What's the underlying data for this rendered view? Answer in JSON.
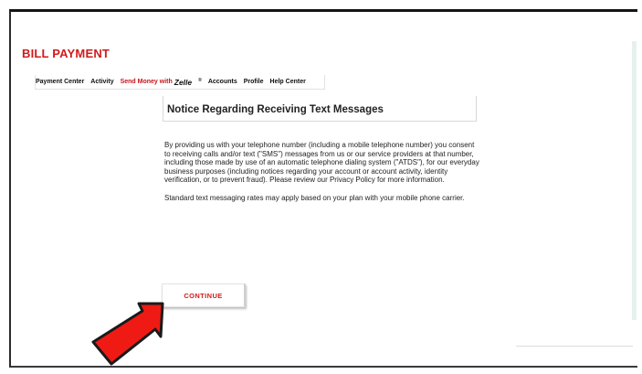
{
  "header": {
    "title": "BILL PAYMENT"
  },
  "nav": {
    "items": [
      {
        "label": "Payment Center"
      },
      {
        "label": "Activity"
      },
      {
        "label": "Send Money with",
        "brand": "Zelle",
        "brand_mark": "®"
      },
      {
        "label": "Accounts"
      },
      {
        "label": "Profile"
      },
      {
        "label": "Help Center"
      }
    ]
  },
  "notice": {
    "title": "Notice Regarding Receiving Text Messages",
    "paragraphs": [
      "By providing us with your telephone number (including a mobile telephone number) you consent to receiving calls and/or text (\"SMS\") messages from us or our service providers at that number, including those made by use of an automatic telephone dialing system (\"ATDS\"), for our everyday business purposes (including notices regarding your account or account activity, identity verification, or to prevent fraud). Please review our Privacy Policy for more information.",
      "Standard text messaging rates may apply based on your plan with your mobile phone carrier."
    ]
  },
  "actions": {
    "continue_label": "CONTINUE"
  },
  "colors": {
    "brand_red": "#d21a1a",
    "arrow_red": "#f01a14"
  },
  "icons": {
    "pointer": "red-arrow-icon"
  }
}
